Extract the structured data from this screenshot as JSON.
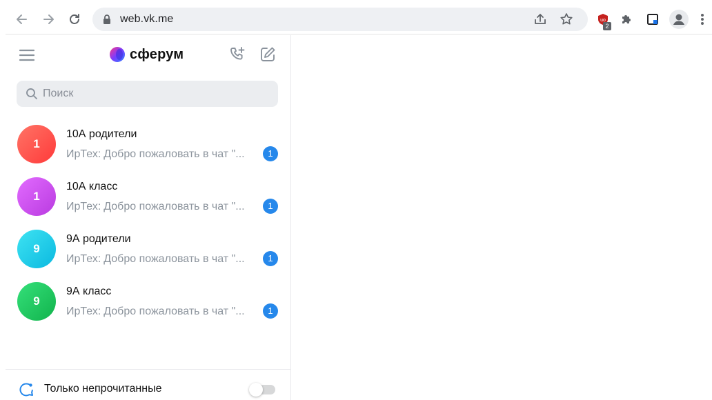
{
  "browser": {
    "url": "web.vk.me",
    "extension_badge": "2"
  },
  "app": {
    "brand": "сферум",
    "brand_colors": [
      "#ff3985",
      "#7b3cff",
      "#2d81ff"
    ]
  },
  "search": {
    "placeholder": "Поиск"
  },
  "chats": [
    {
      "avatar_text": "1",
      "avatar_gradient": [
        "#ff7466",
        "#ff3a3a"
      ],
      "title": "10А родители",
      "author": "ИрТех:",
      "text": "Добро пожаловать в чат \"...",
      "unread": "1"
    },
    {
      "avatar_text": "1",
      "avatar_gradient": [
        "#e26bff",
        "#b93be0"
      ],
      "title": "10А класс",
      "author": "ИрТех:",
      "text": "Добро пожаловать в чат \"...",
      "unread": "1"
    },
    {
      "avatar_text": "9",
      "avatar_gradient": [
        "#3ee3f2",
        "#0bb9e0"
      ],
      "title": "9А родители",
      "author": "ИрТех:",
      "text": "Добро пожаловать в чат \"...",
      "unread": "1"
    },
    {
      "avatar_text": "9",
      "avatar_gradient": [
        "#35e07a",
        "#11b34c"
      ],
      "title": "9А класс",
      "author": "ИрТех:",
      "text": "Добро пожаловать в чат \"...",
      "unread": "1"
    }
  ],
  "footer": {
    "label": "Только непрочитанные",
    "toggle_on": false
  },
  "icons": {
    "back": "arrow-left-icon",
    "forward": "arrow-right-icon",
    "reload": "reload-icon",
    "lock": "lock-icon",
    "share": "share-icon",
    "star": "star-icon",
    "extension": "shield-extension-icon",
    "puzzle": "puzzle-icon",
    "sidepanel": "side-panel-icon",
    "profile": "profile-icon",
    "more": "more-vertical-icon"
  }
}
